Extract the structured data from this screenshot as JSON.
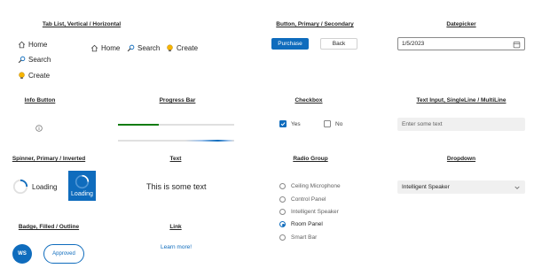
{
  "sections": {
    "tablist": "Tab List, Vertical / Horizontal",
    "buttons": "Button, Primary / Secondary",
    "datepicker": "Datepicker",
    "info": "Info Button",
    "progress": "Progress Bar",
    "checkbox": "Checkbox",
    "textinput": "Text Input, SingleLine / MultiLine",
    "spinner": "Spinner, Primary / Inverted",
    "text": "Text",
    "radio": "Radio Group",
    "dropdown": "Dropdown",
    "badge": "Badge, Filled / Outline",
    "link": "Link"
  },
  "tabs_vertical": [
    {
      "label": "Home",
      "icon": "home-icon"
    },
    {
      "label": "Search",
      "icon": "search-icon"
    },
    {
      "label": "Create",
      "icon": "lightbulb-icon"
    }
  ],
  "tabs_horizontal": [
    {
      "label": "Home",
      "icon": "home-icon"
    },
    {
      "label": "Search",
      "icon": "search-icon"
    },
    {
      "label": "Create",
      "icon": "lightbulb-icon"
    }
  ],
  "buttons": {
    "primary": "Purchase",
    "secondary": "Back"
  },
  "datepicker": {
    "value": "1/5/2023",
    "icon": "calendar-icon"
  },
  "info_icon": "info-icon",
  "progress": {
    "determinate_fraction": 0.35,
    "accent": "#107c10"
  },
  "checkboxes": [
    {
      "label": "Yes",
      "checked": true
    },
    {
      "label": "No",
      "checked": false
    }
  ],
  "text_input": {
    "placeholder": "Enter some text"
  },
  "spinner": {
    "primary_label": "Loading",
    "inverted_label": "Loading",
    "accent": "#0f6cbd"
  },
  "text_sample": "This is some text",
  "radio_options": [
    {
      "label": "Ceiling Microphone",
      "selected": false
    },
    {
      "label": "Control Panel",
      "selected": false
    },
    {
      "label": "Intelligent Speaker",
      "selected": false
    },
    {
      "label": "Room Panel",
      "selected": true
    },
    {
      "label": "Smart Bar",
      "selected": false
    }
  ],
  "dropdown": {
    "value": "Intelligent Speaker",
    "icon": "chevron-down-icon"
  },
  "badges": {
    "filled": "WS",
    "outline": "Approved"
  },
  "link": "Learn more!"
}
